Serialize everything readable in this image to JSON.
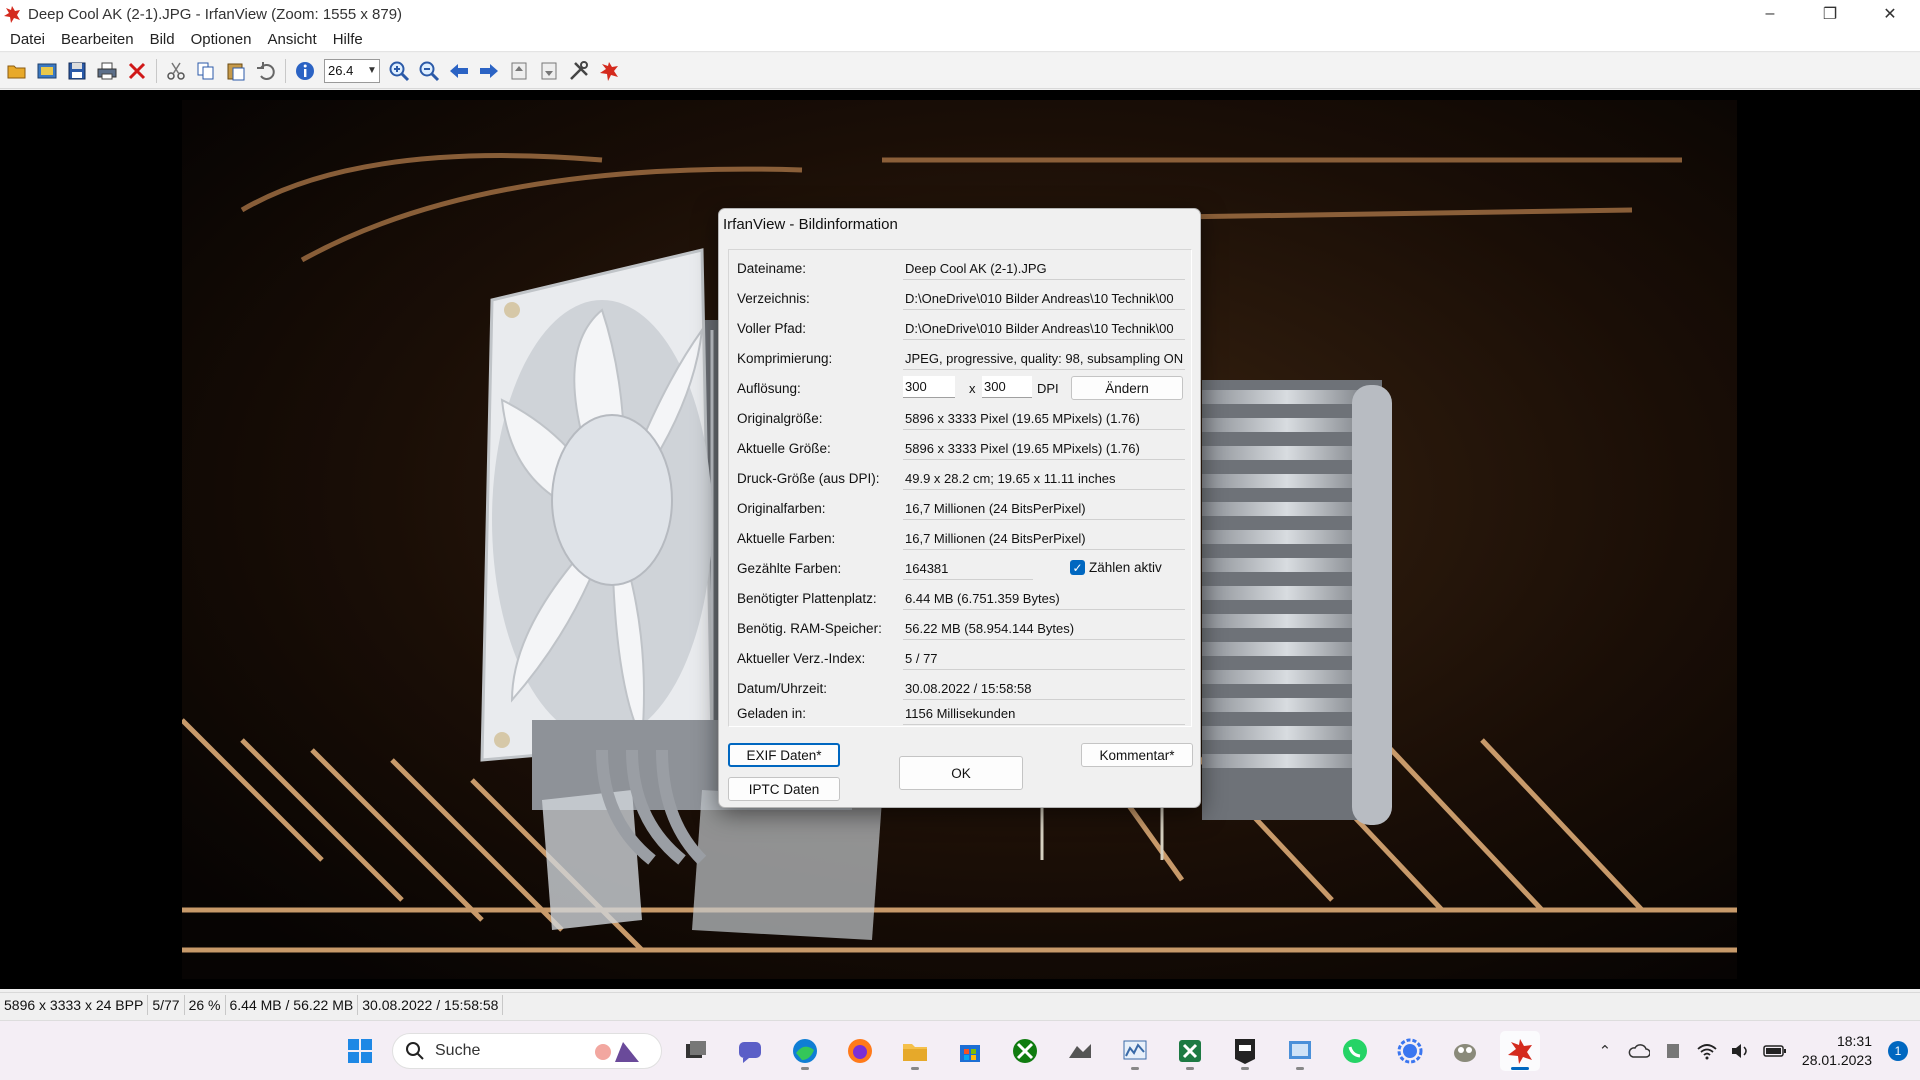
{
  "window": {
    "title": "Deep Cool AK (2-1).JPG - IrfanView (Zoom: 1555 x 879)",
    "minimize": "–",
    "restore": "❐",
    "close": "✕"
  },
  "menu": [
    "Datei",
    "Bearbeiten",
    "Bild",
    "Optionen",
    "Ansicht",
    "Hilfe"
  ],
  "toolbar": {
    "zoom_value": "26.4",
    "icons": [
      "open-folder-icon",
      "slideshow-icon",
      "save-icon",
      "print-icon",
      "delete-icon",
      "cut-icon",
      "copy-icon",
      "paste-icon",
      "undo-icon",
      "info-icon",
      "zoom-in-icon",
      "zoom-out-icon",
      "previous-icon",
      "next-icon",
      "first-page-icon",
      "last-page-icon",
      "settings-icon",
      "irfanview-logo-icon"
    ]
  },
  "dialog": {
    "title": "IrfanView - Bildinformation",
    "rows": [
      {
        "label": "Dateiname:",
        "value": "Deep Cool AK (2-1).JPG"
      },
      {
        "label": "Verzeichnis:",
        "value": "D:\\OneDrive\\010 Bilder Andreas\\10 Technik\\00"
      },
      {
        "label": "Voller Pfad:",
        "value": "D:\\OneDrive\\010 Bilder Andreas\\10 Technik\\00"
      },
      {
        "label": "Komprimierung:",
        "value": "JPEG, progressive, quality: 98, subsampling ON"
      },
      {
        "label": "Auflösung:",
        "value": ""
      },
      {
        "label": "Originalgröße:",
        "value": "5896 x 3333  Pixel (19.65 MPixels) (1.76)"
      },
      {
        "label": "Aktuelle Größe:",
        "value": "5896 x 3333  Pixel (19.65 MPixels) (1.76)"
      },
      {
        "label": "Druck-Größe (aus DPI):",
        "value": "49.9 x 28.2 cm; 19.65 x 11.11 inches"
      },
      {
        "label": "Originalfarben:",
        "value": "16,7 Millionen   (24 BitsPerPixel)"
      },
      {
        "label": "Aktuelle Farben:",
        "value": "16,7 Millionen   (24 BitsPerPixel)"
      },
      {
        "label": "Gezählte Farben:",
        "value": ""
      },
      {
        "label": "Benötigter Plattenplatz:",
        "value": "6.44 MB (6.751.359 Bytes)"
      },
      {
        "label": "Benötig. RAM-Speicher:",
        "value": "56.22  MB (58.954.144 Bytes)"
      },
      {
        "label": "Aktueller Verz.-Index:",
        "value": "5  /  77"
      },
      {
        "label": "Datum/Uhrzeit:",
        "value": "30.08.2022 / 15:58:58"
      },
      {
        "label": "Geladen in:",
        "value": "1156 Millisekunden"
      }
    ],
    "dpi_x": "300",
    "dpi_separator": "x",
    "dpi_y": "300",
    "dpi_unit": "DPI",
    "change_button": "Ändern",
    "counted_colors": "164381",
    "count_active_label": "Zählen aktiv",
    "count_active_checked": true,
    "exif_button": "EXIF Daten*",
    "iptc_button": "IPTC Daten",
    "ok_button": "OK",
    "comment_button": "Kommentar*"
  },
  "status": [
    "5896 x 3333 x 24 BPP",
    "5/77",
    "26 %",
    "6.44 MB / 56.22 MB",
    "30.08.2022 / 15:58:58"
  ],
  "taskbar": {
    "search_placeholder": "Suche",
    "apps": [
      "windows-start-icon",
      "task-view-icon",
      "teams-chat-icon",
      "edge-icon",
      "firefox-icon",
      "file-explorer-icon",
      "store-icon",
      "xbox-icon",
      "app-icon",
      "resource-monitor-icon",
      "excel-icon",
      "epic-games-icon",
      "control-panel-icon",
      "whatsapp-icon",
      "signal-icon",
      "gimp-icon",
      "irfanview-icon"
    ],
    "time": "18:31",
    "date": "28.01.2023",
    "notification_count": "1"
  },
  "colors": {
    "accent": "#0067c0",
    "taskbar": "#f4eef5",
    "viewer_bg": "#000000"
  }
}
